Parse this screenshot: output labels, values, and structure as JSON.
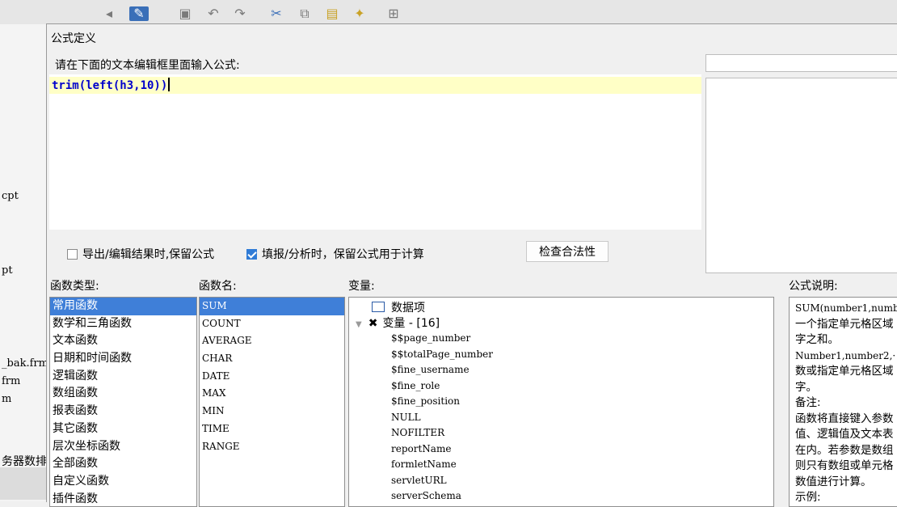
{
  "background_app": {
    "files": [
      "cpt",
      "pt",
      "_bak.frm",
      "frm",
      "m"
    ],
    "server_label": "务器数排"
  },
  "dialog": {
    "title": "公式定义",
    "prompt": "请在下面的文本编辑框里面输入公式:",
    "formula": "trim(left(h3,10))",
    "options": {
      "export_keep_formula": {
        "label": "导出/编辑结果时,保留公式",
        "checked": false
      },
      "fill_keep_formula": {
        "label": "填报/分析时，保留公式用于计算",
        "checked": true
      }
    },
    "check_button": "检查合法性",
    "sections": {
      "categories_label": "函数类型:",
      "functions_label": "函数名:",
      "variables_label": "变量:",
      "description_label": "公式说明:"
    },
    "categories": [
      "常用函数",
      "数学和三角函数",
      "文本函数",
      "日期和时间函数",
      "逻辑函数",
      "数组函数",
      "报表函数",
      "其它函数",
      "层次坐标函数",
      "全部函数",
      "自定义函数",
      "插件函数"
    ],
    "selected_category": "常用函数",
    "functions": [
      "SUM",
      "COUNT",
      "AVERAGE",
      "CHAR",
      "DATE",
      "MAX",
      "MIN",
      "TIME",
      "RANGE"
    ],
    "selected_function": "SUM",
    "variables": {
      "data_item": "数据项",
      "variable_group": "变量 - [16]",
      "items": [
        "$$page_number",
        "$$totalPage_number",
        "$fine_username",
        "$fine_role",
        "$fine_position",
        "NULL",
        "NOFILTER",
        "reportName",
        "formletName",
        "servletURL",
        "serverSchema"
      ]
    },
    "description": [
      "SUM(number1,numbe",
      "一个指定单元格区域",
      "字之和。",
      "Number1,number2,·",
      "数或指定单元格区域",
      "字。",
      "备注:",
      "函数将直接键入参数",
      "值、逻辑值及文本表",
      "在内。若参数是数组",
      "则只有数组或单元格",
      "数值进行计算。",
      "示例:"
    ]
  },
  "colors": {
    "selection": "#3f7fd8",
    "formula_text": "#0000cc",
    "editor_highlight": "#ffffc6"
  }
}
